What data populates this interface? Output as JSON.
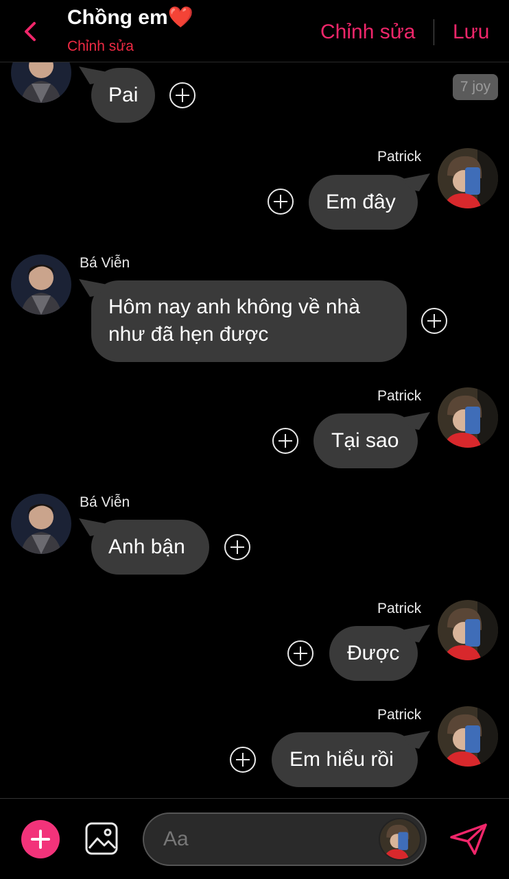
{
  "header": {
    "title": "Chồng em",
    "title_emoji": "❤️",
    "subtitle": "Chỉnh sửa",
    "edit_label": "Chỉnh sửa",
    "save_label": "Lưu",
    "accent_color": "#f0266a"
  },
  "timestamp_badge": "7 joy",
  "messages": [
    {
      "sender": "",
      "side": "left",
      "text": "Pai"
    },
    {
      "sender": "Patrick",
      "side": "right",
      "text": "Em đây"
    },
    {
      "sender": "Bá Viễn",
      "side": "left",
      "text_lines": [
        "Hôm nay anh không về nhà",
        "như đã hẹn được"
      ]
    },
    {
      "sender": "Patrick",
      "side": "right",
      "text": "Tại sao"
    },
    {
      "sender": "Bá Viễn",
      "side": "left",
      "text": "Anh bận"
    },
    {
      "sender": "Patrick",
      "side": "right",
      "text": "Được"
    },
    {
      "sender": "Patrick",
      "side": "right",
      "text": "Em hiểu rồi"
    }
  ],
  "footer": {
    "input_placeholder": "Aa",
    "icons": [
      "add-icon",
      "image-icon",
      "send-icon"
    ]
  }
}
